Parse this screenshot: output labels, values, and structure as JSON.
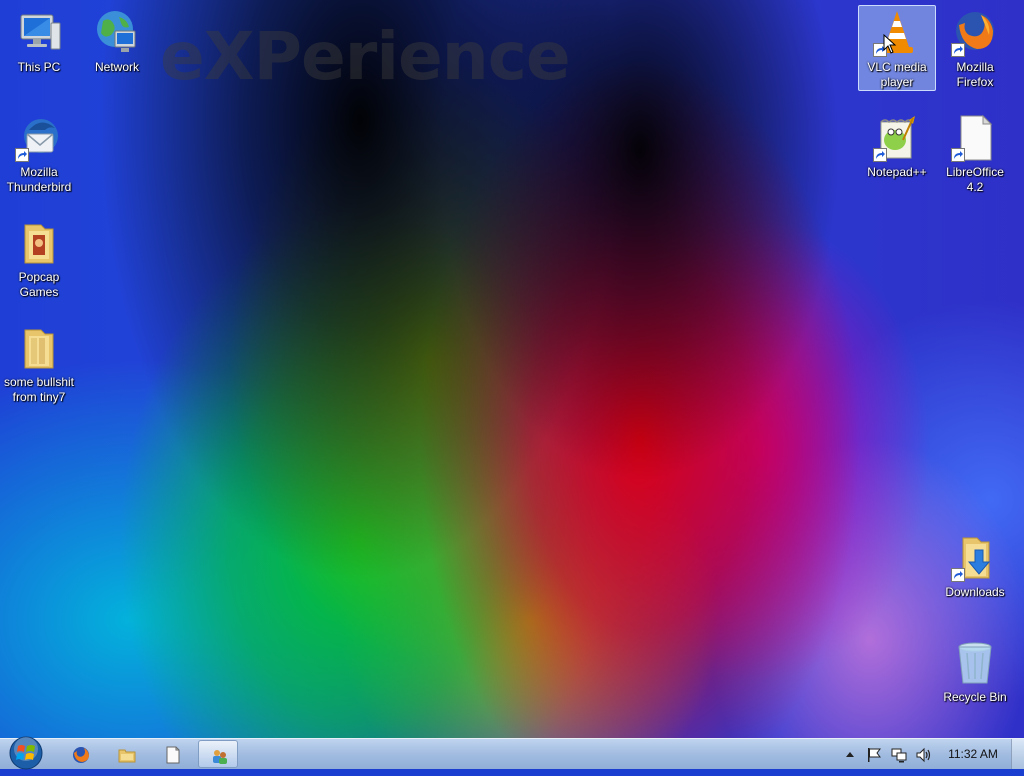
{
  "wallpaper": {
    "watermark": "eXPerience"
  },
  "desktop_icons": [
    {
      "label": "This PC",
      "icon": "computer-icon"
    },
    {
      "label": "Network",
      "icon": "network-icon"
    },
    {
      "label": "Mozilla\nThunderbird",
      "icon": "thunderbird-icon"
    },
    {
      "label": "Popcap\nGames",
      "icon": "folder-icon"
    },
    {
      "label": "some bullshit\nfrom tiny7",
      "icon": "folder-icon"
    },
    {
      "label": "VLC media\nplayer",
      "icon": "vlc-icon",
      "selected": true
    },
    {
      "label": "Mozilla\nFirefox",
      "icon": "firefox-icon"
    },
    {
      "label": "Notepad++",
      "icon": "notepadpp-icon"
    },
    {
      "label": "LibreOffice\n4.2",
      "icon": "libreoffice-icon"
    },
    {
      "label": "Downloads",
      "icon": "downloads-folder-icon"
    },
    {
      "label": "Recycle Bin",
      "icon": "recycle-bin-icon"
    }
  ],
  "taskbar": {
    "pinned": [
      "firefox-icon",
      "explorer-icon",
      "document-icon",
      "control-panel-icon"
    ],
    "tray": [
      "show-hidden-icons",
      "action-center-flag-icon",
      "network-icon",
      "volume-icon"
    ],
    "clock": "11:32 AM"
  }
}
